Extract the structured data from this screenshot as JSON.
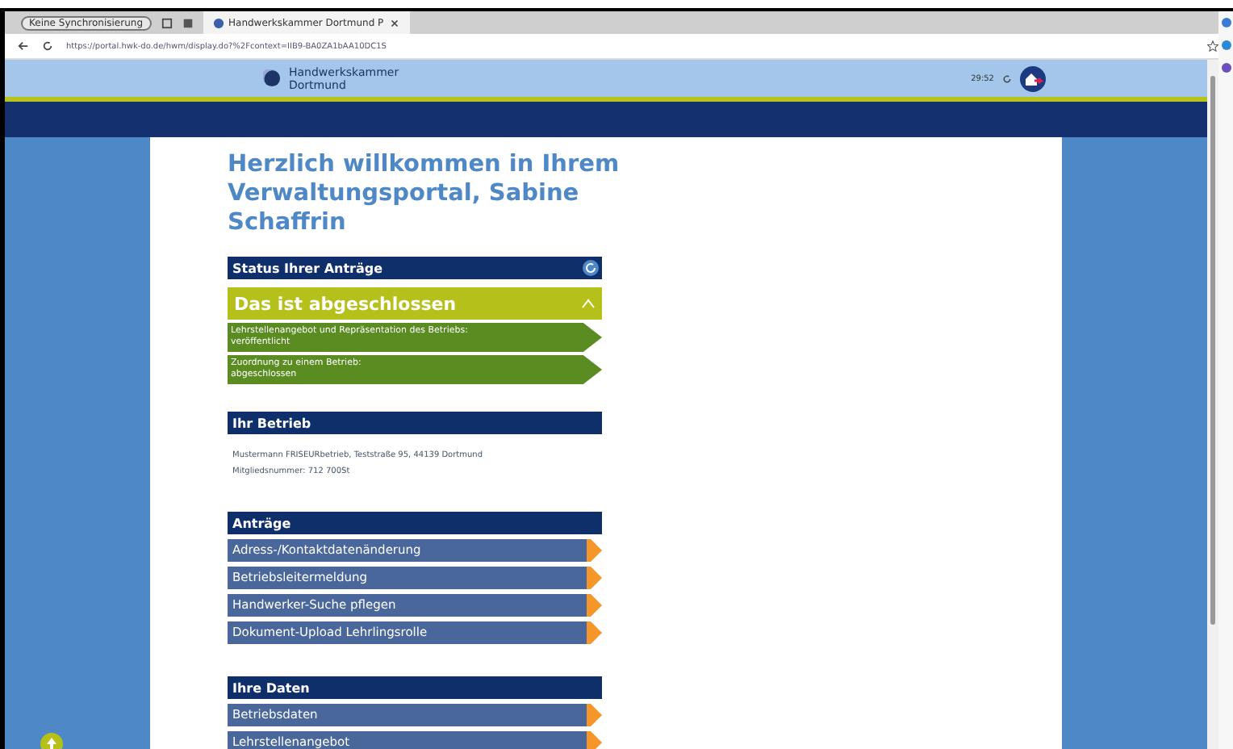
{
  "browser": {
    "profile": "Keine Synchronisierung",
    "tab_title": "Handwerkskammer Dortmund P",
    "url": "https://portal.hwk-do.de/hwm/display.do?%2Fcontext=IIB9-BA0ZA1bAA10DC1S"
  },
  "header": {
    "logo_text": "Handwerkskammer Dortmund",
    "timer": "29:52"
  },
  "welcome": "Herzlich willkommen in Ihrem Verwaltungsportal, Sabine Schaffrin",
  "status": {
    "title": "Status Ihrer Anträge",
    "group": {
      "title": "Das ist abgeschlossen",
      "expanded": true,
      "items": [
        {
          "label": "Lehrstellenangebot und Repräsentation des Betriebs:",
          "value": "veröffentlicht"
        },
        {
          "label": "Zuordnung zu einem Betrieb:",
          "value": "abgeschlossen"
        }
      ]
    }
  },
  "betrieb": {
    "title": "Ihr Betrieb",
    "lines": [
      "Mustermann FRISEURbetrieb, Teststraße 95, 44139 Dortmund",
      "Mitgliedsnummer: 712 700St"
    ]
  },
  "sections": [
    {
      "title": "Anträge",
      "links": [
        "Adress-/Kontaktdatenänderung",
        "Betriebsleitermeldung",
        "Handwerker-Suche pflegen",
        "Dokument-Upload Lehrlingsrolle"
      ]
    },
    {
      "title": "Ihre Daten",
      "links": [
        "Betriebsdaten",
        "Lehrstellenangebot"
      ]
    }
  ]
}
